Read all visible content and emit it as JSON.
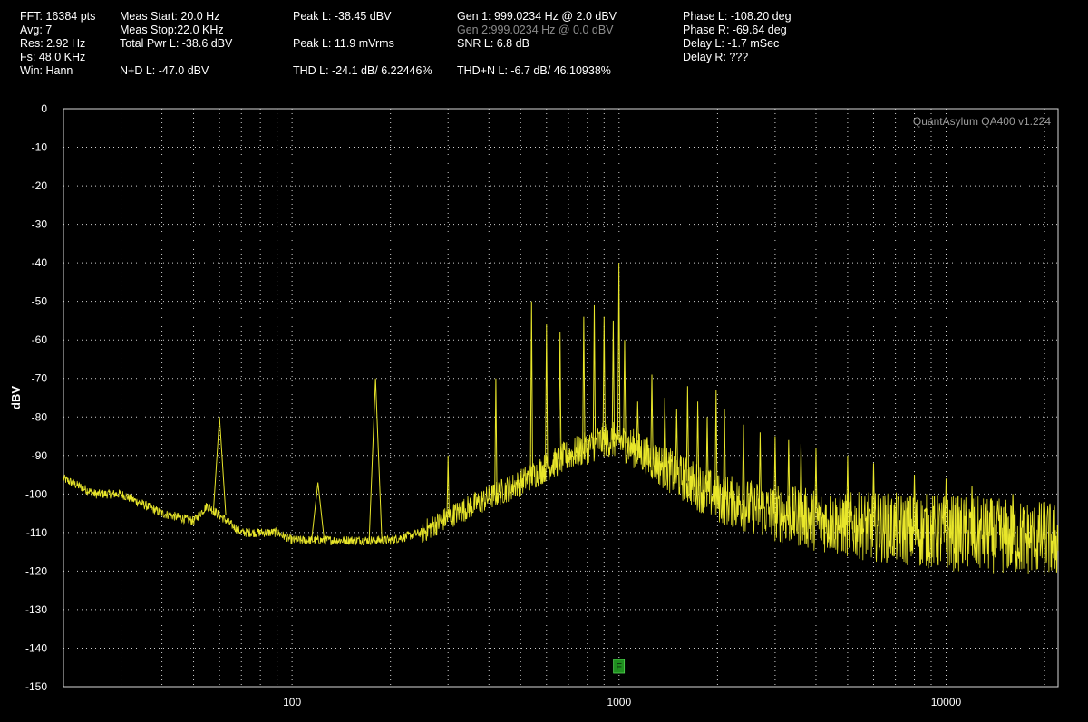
{
  "readouts": {
    "col1": [
      "FFT: 16384 pts",
      "Avg: 7",
      "Res: 2.92 Hz",
      "Fs: 48.0 KHz",
      "Win: Hann"
    ],
    "col2": [
      "Meas Start: 20.0 Hz",
      "Meas Stop:22.0 KHz",
      "Total Pwr L: -38.6 dBV",
      "N+D L: -47.0 dBV"
    ],
    "col3": [
      "Peak L: -38.45 dBV",
      "Peak L: 11.9 mVrms",
      "THD L: -24.1 dB/ 6.22446%"
    ],
    "col4": [
      "Gen 1: 999.0234 Hz @ 2.0  dBV",
      "Gen 2:999.0234 Hz @ 0.0  dBV",
      "SNR L: 6.8 dB",
      "THD+N L: -6.7 dB/ 46.10938%"
    ],
    "col5": [
      "Phase L: -108.20 deg",
      "Phase R: -69.64 deg",
      "Delay L: -1.7 mSec",
      "Delay R: ???"
    ]
  },
  "plot": {
    "watermark": "QuantAsylum QA400 v1.224",
    "marker_label": "F",
    "colors": {
      "trace": "#e8e62a",
      "grid": "#d0d0d0",
      "marker": "#1f8f1f",
      "watermark": "#9a9a9a"
    }
  },
  "chart_data": {
    "type": "line",
    "xscale": "log",
    "xlim": [
      20,
      22000
    ],
    "ylim": [
      -150,
      0
    ],
    "ylabel": "dBV",
    "xticks": [
      100,
      1000,
      10000
    ],
    "xtick_labels": [
      "100",
      "1000",
      "10000"
    ],
    "yticks": [
      0,
      -10,
      -20,
      -30,
      -40,
      -50,
      -60,
      -70,
      -80,
      -90,
      -100,
      -110,
      -120,
      -130,
      -140,
      -150
    ],
    "ytick_labels": [
      "0",
      "-10",
      "-20",
      "-30",
      "-40",
      "-50",
      "-60",
      "-70",
      "-80",
      "-90",
      "-100",
      "-110",
      "-120",
      "-130",
      "-140",
      "-150"
    ],
    "grid": true,
    "marker_x": 999.0234,
    "baseline": {
      "x": [
        20,
        25,
        30,
        40,
        50,
        55,
        70,
        90,
        100,
        120,
        150,
        200,
        250,
        300,
        400,
        500,
        600,
        700,
        800,
        900,
        1000,
        1100,
        1200,
        1500,
        2000,
        3000,
        5000,
        10000,
        15000,
        22000
      ],
      "y": [
        -96,
        -100,
        -100,
        -105,
        -107,
        -103,
        -110,
        -110,
        -112,
        -112,
        -112,
        -112,
        -110,
        -106,
        -101,
        -97,
        -93,
        -90,
        -88,
        -86,
        -86,
        -88,
        -90,
        -95,
        -101,
        -105,
        -108,
        -110,
        -111,
        -112
      ]
    },
    "peaks": {
      "x": [
        60,
        120,
        180,
        300,
        420,
        540,
        600,
        660,
        780,
        840,
        900,
        960,
        999,
        1040,
        1140,
        1260,
        1380,
        1500,
        1620,
        1740,
        1860,
        1980,
        2100,
        2400,
        2700,
        3000,
        3300,
        3600,
        4000,
        5000,
        6000,
        8000,
        10000,
        12000,
        16000,
        20000
      ],
      "y": [
        -80,
        -97,
        -70,
        -90,
        -70,
        -50,
        -56,
        -58,
        -54,
        -51,
        -54,
        -55,
        -40,
        -60,
        -76,
        -69,
        -75,
        -78,
        -72,
        -76,
        -80,
        -73,
        -78,
        -82,
        -84,
        -85,
        -86,
        -87,
        -88,
        -90,
        -92,
        -95,
        -96,
        -98,
        -100,
        -102
      ]
    }
  }
}
